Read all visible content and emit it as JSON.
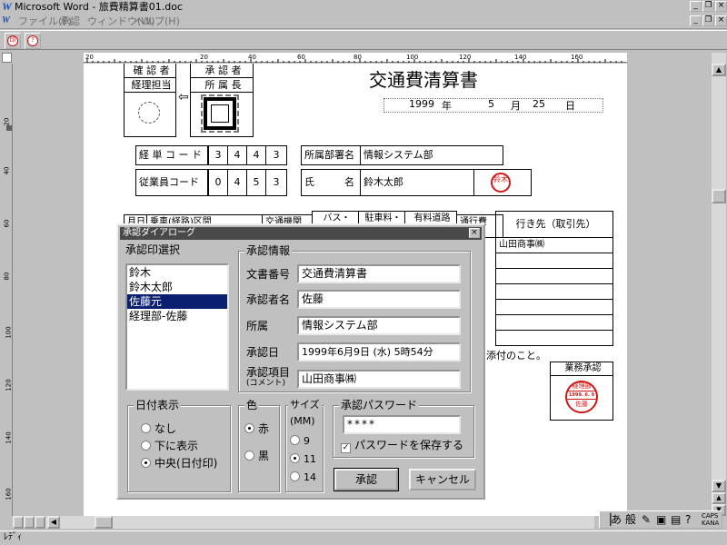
{
  "window": {
    "title": "Microsoft Word - 旅費精算書01.doc"
  },
  "menu": [
    "ファイル(F)",
    "承認",
    "ウィンドウ(W)",
    "ヘルプ(H)"
  ],
  "ruler": {
    "h_labels": [
      "20",
      "20",
      "40",
      "60",
      "80",
      "100",
      "120",
      "140",
      "160"
    ],
    "v_labels": [
      "20",
      "40",
      "60",
      "80",
      "100",
      "120",
      "140",
      "160"
    ]
  },
  "document": {
    "title": "交通費清算書",
    "date": {
      "year": "1999",
      "year_unit": "年",
      "month": "5",
      "month_unit": "月",
      "day": "25",
      "day_unit": "日"
    },
    "stamp_boxes": {
      "confirmer_label": "確 認 者",
      "manager_label": "経理担当",
      "approver_label": "承 認 者",
      "dept_head_label": "所 属 長"
    },
    "info": {
      "expense_code_label": "経 単 コ ー ド",
      "expense_code_digits": [
        "3",
        "4",
        "4",
        "3"
      ],
      "dept_label": "所属部署名",
      "dept_value": "情報システム部",
      "employee_code_label": "従業員コード",
      "employee_code_digits": [
        "0",
        "4",
        "5",
        "3"
      ],
      "name_label": "氏　　　名",
      "name_value": "鈴木太郎",
      "name_seal": "鈴木"
    },
    "table": {
      "headers": [
        "月日",
        "乗車(経路)区間",
        "交通機関",
        "バス・",
        "駐車料・",
        "有料道路",
        "通行費",
        "行き先（取引先）"
      ],
      "first_destination": "山田商事㈱"
    },
    "note": "添付のこと。",
    "business_approval_label": "業務承認",
    "approval_stamp": {
      "top": "経理部",
      "date": "1999. 6. 9",
      "name": "佐藤"
    }
  },
  "dialog": {
    "title": "承認ダイアローグ",
    "stamp_select_label": "承認印選択",
    "stamp_options": [
      "鈴木",
      "鈴木太郎",
      "佐藤元",
      "経理部-佐藤"
    ],
    "stamp_selected_index": 2,
    "info_group_label": "承認情報",
    "doc_number_label": "文書番号",
    "doc_number_value": "交通費清算書",
    "approver_label": "承認者名",
    "approver_value": "佐藤",
    "affiliation_label": "所属",
    "affiliation_value": "情報システム部",
    "approval_date_label": "承認日",
    "approval_date_value": "1999年6月9日 (水) 5時54分",
    "approval_item_label": "承認項目",
    "approval_item_sublabel": "(コメント)",
    "approval_item_value": "山田商事㈱",
    "date_display": {
      "label": "日付表示",
      "options": [
        "なし",
        "下に表示",
        "中央(日付印)"
      ],
      "selected": 2
    },
    "color": {
      "label": "色",
      "options": [
        "赤",
        "黒"
      ],
      "selected": 0
    },
    "size": {
      "label": "サイズ",
      "unit": "(MM)",
      "options": [
        "9",
        "11",
        "14"
      ],
      "selected": 1
    },
    "password": {
      "label": "承認パスワード",
      "value": "****",
      "save_label": "パスワードを保存する",
      "save_checked": true
    },
    "ok_label": "承認",
    "cancel_label": "キャンセル"
  },
  "ime": {
    "mode": "あ",
    "kanji": "般"
  },
  "status": "ﾚﾃﾞｨ",
  "colors": {
    "seal_red": "#d01818",
    "dialog_titlebar": "#4a4a4a",
    "selection": "#0a1f6f"
  }
}
